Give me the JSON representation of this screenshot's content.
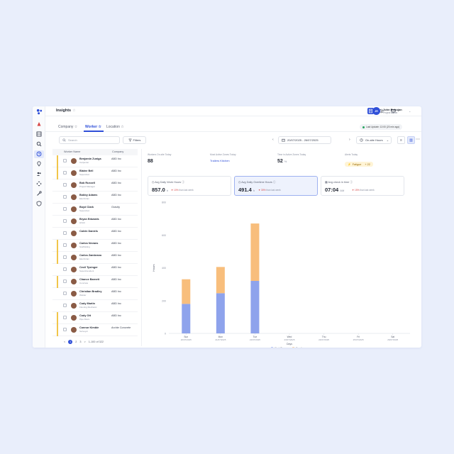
{
  "app": {
    "title": "Insights",
    "user": {
      "name": "John Robojan",
      "role": "Project Admin",
      "initials": "JR"
    }
  },
  "tabs": [
    {
      "label": "Company"
    },
    {
      "label": "Worker"
    },
    {
      "label": "Location"
    }
  ],
  "last_update": "Last Update: 12:00 (20 min ago)",
  "toolbar": {
    "search_placeholder": "Search",
    "filters_label": "Filters",
    "date_range": "20/07/2025 - 26/07/2025",
    "metric_select": "On-site Hours"
  },
  "worker_list": {
    "headers": {
      "name": "Worker Name",
      "company": "Company"
    },
    "rows": [
      {
        "name": "Benjamin Zuniga",
        "role": "Carpenter",
        "company": "ABD Inc",
        "flag": true
      },
      {
        "name": "Blaine Bell",
        "role": "Supervisor",
        "company": "ABD Inc",
        "flag": true
      },
      {
        "name": "Bob Russell",
        "role": "Project Manager",
        "company": "ABD Inc",
        "flag": false
      },
      {
        "name": "Bobby Adams",
        "role": "Electrician",
        "company": "ABD Inc",
        "flag": false
      },
      {
        "name": "Boyd Clark",
        "role": "Supervisor",
        "company": "Gravity",
        "flag": false
      },
      {
        "name": "Bryan Edwards",
        "role": "HVAC",
        "company": "ABD Inc",
        "flag": false
      },
      {
        "name": "Calvin Daniels",
        "role": "",
        "company": "ABD Inc",
        "flag": false
      },
      {
        "name": "Carlos Nevans",
        "role": "Scaffolding",
        "company": "ABD Inc",
        "flag": true
      },
      {
        "name": "Carlos Zambrano",
        "role": "Electrician",
        "company": "ABD Inc",
        "flag": true
      },
      {
        "name": "Cecil Tysinger",
        "role": "Superintendent",
        "company": "ABD Inc",
        "flag": false
      },
      {
        "name": "Chance Barnett",
        "role": "Concrete",
        "company": "ABD Inc",
        "flag": true
      },
      {
        "name": "Christian Bradley",
        "role": "Welder",
        "company": "ABD Inc",
        "flag": false
      },
      {
        "name": "Cody Martin",
        "role": "Flooring Mechanic",
        "company": "ABD Inc",
        "flag": false
      },
      {
        "name": "Cody Ott",
        "role": "Pipe fitters",
        "company": "ABD Inc",
        "flag": true
      },
      {
        "name": "Connor Kimble",
        "role": "Surveyor",
        "company": "Archie Concrete",
        "flag": true
      }
    ]
  },
  "pagination": {
    "pages": [
      "1",
      "2",
      "3"
    ],
    "current": "1",
    "next": ">",
    "prev": "<",
    "summary": "1-100 of 322"
  },
  "stats": [
    {
      "label": "Workers On-site Today",
      "value": "88"
    },
    {
      "label": "Most Active Zones Today",
      "value": "Trailers Kitchen"
    },
    {
      "label": "Time in Active Zones Today",
      "value": "52",
      "unit": "%"
    },
    {
      "label": "Alerts Today",
      "badge": "Fatigue",
      "count": "+ 22"
    }
  ],
  "kpis": [
    {
      "title": "Avg Daily Work Hours",
      "value": "857.0",
      "unit": "h",
      "delta": "▼ 10%",
      "delta_note": "than last week"
    },
    {
      "title": "Avg Daily Overtime Hours",
      "value": "491.4",
      "unit": "h",
      "delta": "▼ 30%",
      "delta_note": "than last week"
    },
    {
      "title": "Avg check in time",
      "value": "07:04",
      "unit": "AM",
      "delta": "▼ 15%",
      "delta_note": "than last week"
    }
  ],
  "chart_data": {
    "type": "bar",
    "stacked": true,
    "categories": [
      "Sun 20/07/2025",
      "Mon 21/07/2025",
      "Tue 22/07/2025",
      "Wed 23/07/2025",
      "Thu 24/07/2025",
      "Fri 25/07/2025",
      "Sat 26/07/2025"
    ],
    "category_day": [
      "Sun",
      "Mon",
      "Tue",
      "Wed",
      "Thu",
      "Fri",
      "Sat"
    ],
    "category_date": [
      "20/07/2025",
      "21/07/2025",
      "22/07/2025",
      "23/07/2025",
      "24/07/2025",
      "25/07/2025",
      "26/07/2025"
    ],
    "series": [
      {
        "name": "Work Time",
        "color": "#8ea3ec",
        "values": [
          180,
          245,
          320,
          0,
          0,
          0,
          0
        ]
      },
      {
        "name": "Overtime",
        "color": "#f8be7c",
        "values": [
          150,
          160,
          350,
          0,
          0,
          0,
          0
        ]
      }
    ],
    "xlabel": "Days",
    "ylabel": "Hours",
    "ylim": [
      0,
      800
    ],
    "yticks": [
      0,
      200,
      400,
      600,
      800
    ],
    "grid": false,
    "legend": "bottom"
  }
}
